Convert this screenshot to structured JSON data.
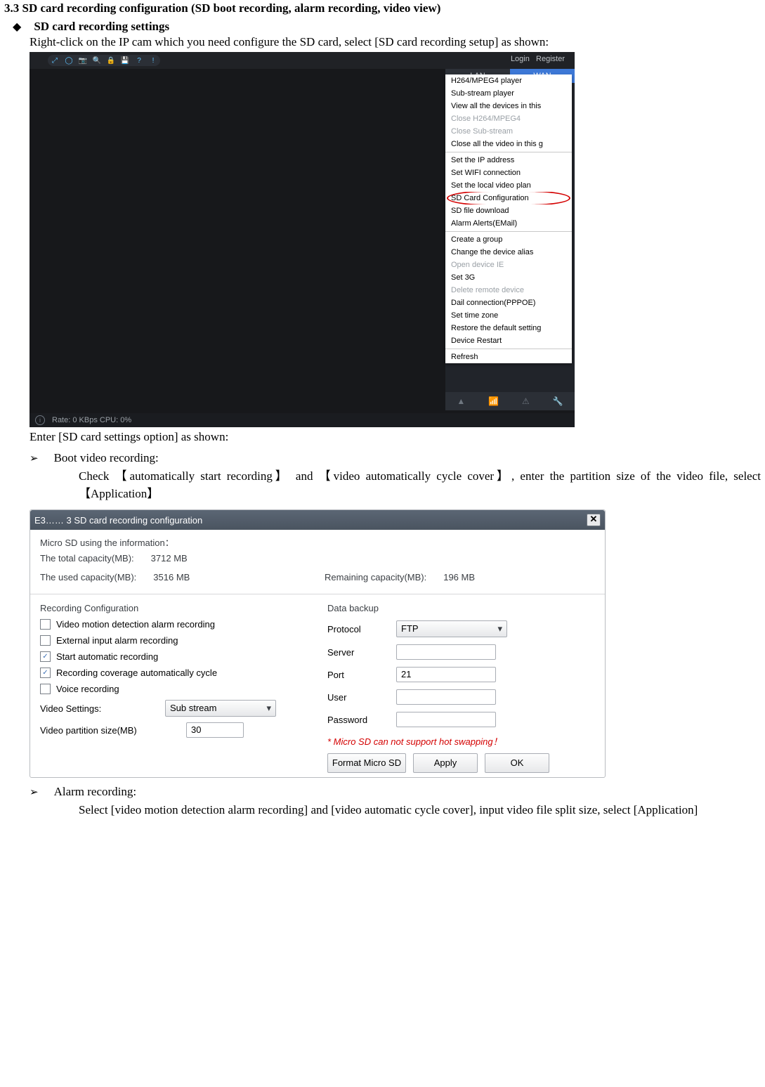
{
  "doc": {
    "h33": "3.3 SD card recording configuration (SD boot recording, alarm recording, video view)",
    "sub1_label": "SD card recording settings",
    "intro": "Right-click on the IP cam which you need configure the SD card, select [SD card recording setup] as shown:",
    "cap2": "Enter [SD card settings option] as shown:",
    "bvr_label": "Boot video recording:",
    "bvr_body": "Check 【automatically start recording】 and 【video automatically cycle cover】, enter the partition size of the video file, select 【Application】",
    "alr_label": "Alarm recording:",
    "alr_body": "Select [video motion detection alarm recording] and [video automatic cycle cover], input video file split size, select [Application]"
  },
  "shot1": {
    "login": "Login",
    "register": "Register",
    "tab_lan": "LAN",
    "tab_wan": "WAN",
    "status": "Rate: 0 KBps  CPU:  0%",
    "ctx": [
      {
        "t": "H264/MPEG4 player"
      },
      {
        "t": "Sub-stream player"
      },
      {
        "t": "View all the devices in this"
      },
      {
        "t": "Close H264/MPEG4",
        "dis": true
      },
      {
        "t": "Close Sub-stream",
        "dis": true
      },
      {
        "t": "Close all the video in this g"
      },
      {
        "sep": true
      },
      {
        "t": "Set the IP address"
      },
      {
        "t": "Set WIFI connection"
      },
      {
        "t": "Set the local video plan"
      },
      {
        "t": "SD Card Configuration",
        "circled": true
      },
      {
        "t": "SD file download"
      },
      {
        "t": "Alarm Alerts(EMail)"
      },
      {
        "sep": true
      },
      {
        "t": "Create a group"
      },
      {
        "t": "Change the device alias"
      },
      {
        "t": "Open device IE",
        "dis": true
      },
      {
        "t": "Set 3G"
      },
      {
        "t": "Delete remote device",
        "dis": true
      },
      {
        "t": "Dail connection(PPPOE)"
      },
      {
        "t": "Set time zone"
      },
      {
        "t": "Restore the default setting"
      },
      {
        "t": "Device Restart"
      },
      {
        "sep": true
      },
      {
        "t": "Refresh"
      }
    ]
  },
  "dlg": {
    "title": "E3…… 3 SD card recording configuration",
    "info_title": "Micro SD using the information：",
    "total_label": "The total capacity(MB):",
    "total_val": "3712 MB",
    "used_label": "The used capacity(MB):",
    "used_val": "3516 MB",
    "remain_label": "Remaining capacity(MB):",
    "remain_val": "196 MB",
    "rec_title": "Recording Configuration",
    "backup_title": "Data backup",
    "cb_motion": "Video motion detection alarm recording",
    "cb_ext": "External input alarm recording",
    "cb_auto": "Start automatic recording",
    "cb_cycle": "Recording coverage automatically cycle",
    "cb_voice": "Voice recording",
    "vsettings_label": "Video Settings:",
    "vsettings_val": "Sub stream",
    "vpart_label": "Video partition size(MB)",
    "vpart_val": "30",
    "proto_label": "Protocol",
    "proto_val": "FTP",
    "server_label": "Server",
    "server_val": "",
    "port_label": "Port",
    "port_val": "21",
    "user_label": "User",
    "user_val": "",
    "pass_label": "Password",
    "pass_val": "",
    "warn": "* Micro SD can not support hot swapping！",
    "btn_format": "Format Micro SD",
    "btn_apply": "Apply",
    "btn_ok": "OK"
  }
}
